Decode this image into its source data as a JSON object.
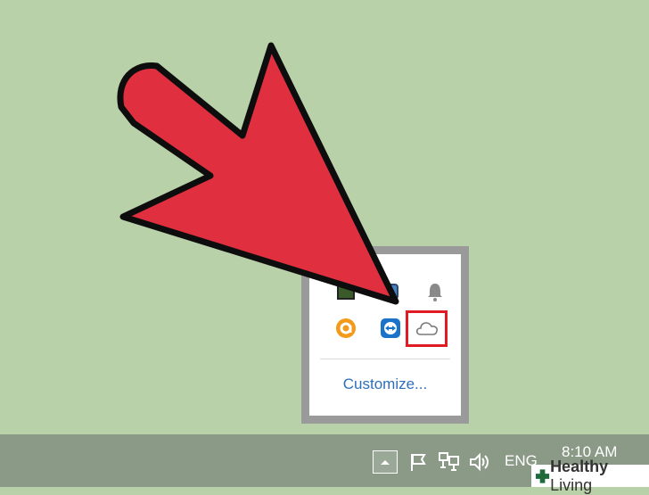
{
  "tray_popup": {
    "customize_label": "Customize...",
    "icons": [
      "green-app-icon",
      "blue-app-icon",
      "notification-bell-icon",
      "avast-icon",
      "teamviewer-icon",
      "onedrive-cloud-icon"
    ],
    "highlight_color": "#e01b24"
  },
  "taskbar": {
    "language": "ENG",
    "time": "8:10 AM",
    "icons": [
      "show-hidden-icons-button",
      "action-center-flag-icon",
      "network-icon",
      "volume-icon"
    ]
  },
  "watermark": {
    "brand_bold": "Healthy",
    "brand_light": "Living"
  },
  "colors": {
    "desktop_bg": "#b9d1a8",
    "arrow_fill": "#e03040",
    "link": "#2f6fb8"
  }
}
